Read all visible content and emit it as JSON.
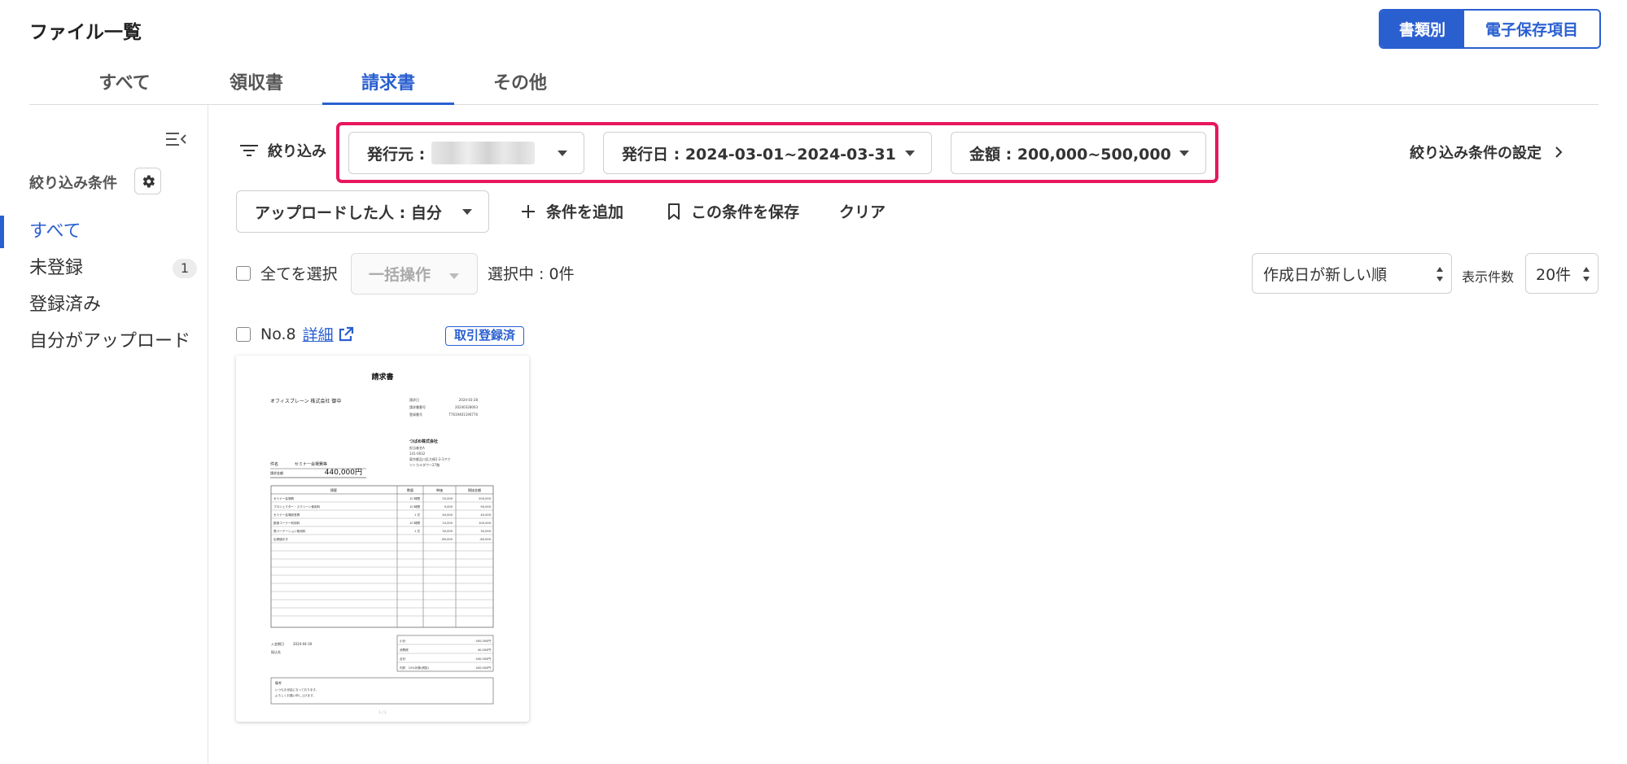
{
  "header": {
    "title": "ファイル一覧",
    "view_toggle": {
      "by_document": "書類別",
      "by_e_storage": "電子保存項目"
    }
  },
  "tabs": [
    "すべて",
    "領収書",
    "請求書",
    "その他"
  ],
  "sidebar": {
    "filter_conditions_title": "絞り込み条件",
    "items": [
      {
        "label": "すべて"
      },
      {
        "label": "未登録",
        "count": "1"
      },
      {
        "label": "登録済み"
      },
      {
        "label": "自分がアップロード"
      }
    ]
  },
  "filters": {
    "label": "絞り込み",
    "issuer_label": "発行元 :",
    "issue_date": "発行日 : 2024-03-01~2024-03-31",
    "amount": "金額 : 200,000~500,000",
    "uploader": "アップロードした人 : 自分",
    "add_condition": "条件を追加",
    "save_condition": "この条件を保存",
    "clear": "クリア",
    "settings": "絞り込み条件の設定"
  },
  "list_controls": {
    "select_all": "全てを選択",
    "bulk_action": "一括操作",
    "selected_count": "選択中 : 0件",
    "sort": "作成日が新しい順",
    "per_page_label": "表示件数",
    "per_page": "20件"
  },
  "files": [
    {
      "number": "No.8",
      "detail_link": "詳細",
      "status": "取引登録済",
      "preview": {
        "title": "請求書",
        "recipient": "オフィスプレーン 株式会社 御中",
        "meta": [
          {
            "label": "請求日",
            "value": "2024-03-28"
          },
          {
            "label": "請求書番号",
            "value": "20240328003"
          },
          {
            "label": "登録番号",
            "value": "T7619401190776"
          }
        ],
        "issuer": [
          "つばめ株式会社",
          "担当者名A",
          "141-0032",
          "東京都品川区大崎1-2-3アク",
          "ツトカルダワー27階"
        ],
        "subject_label": "件名",
        "subject": "セミナー会場費等",
        "amount_label": "請求金額",
        "amount": "440,000円",
        "table_headers": [
          "摘要",
          "数量",
          "単価",
          "税抜金額"
        ],
        "rows": [
          [
            "セミナー会場費",
            "10 時間",
            "20,000",
            "200,000"
          ],
          [
            "プロジェクター・スクリーン使用料",
            "10 時間",
            "9,000",
            "90,000"
          ],
          [
            "セミナー会場設営費",
            "1 式",
            "40,000",
            "40,000"
          ],
          [
            "飲食コーナー利用料",
            "10 時間",
            "10,000",
            "100,000"
          ],
          [
            "長パーテーション使用料",
            "1 式",
            "30,000",
            "30,000"
          ],
          [
            "出張値引き",
            "",
            "-80,000",
            "-80,000"
          ]
        ],
        "due_label": "入金期日",
        "due_date": "2024-04-30",
        "bank_label": "振込先",
        "totals": [
          {
            "label": "小計",
            "value": "400,000円"
          },
          {
            "label": "消費税",
            "value": "40,000円"
          },
          {
            "label": "合計",
            "value": "440,000円"
          },
          {
            "label": "内訳　10%対象(税抜)",
            "value": "400,000円"
          }
        ],
        "notes_label": "備考",
        "notes": [
          "いつもお世話になっております。",
          "よろしくお願い申し上げます。"
        ],
        "page": "1 / 1"
      }
    }
  ]
}
